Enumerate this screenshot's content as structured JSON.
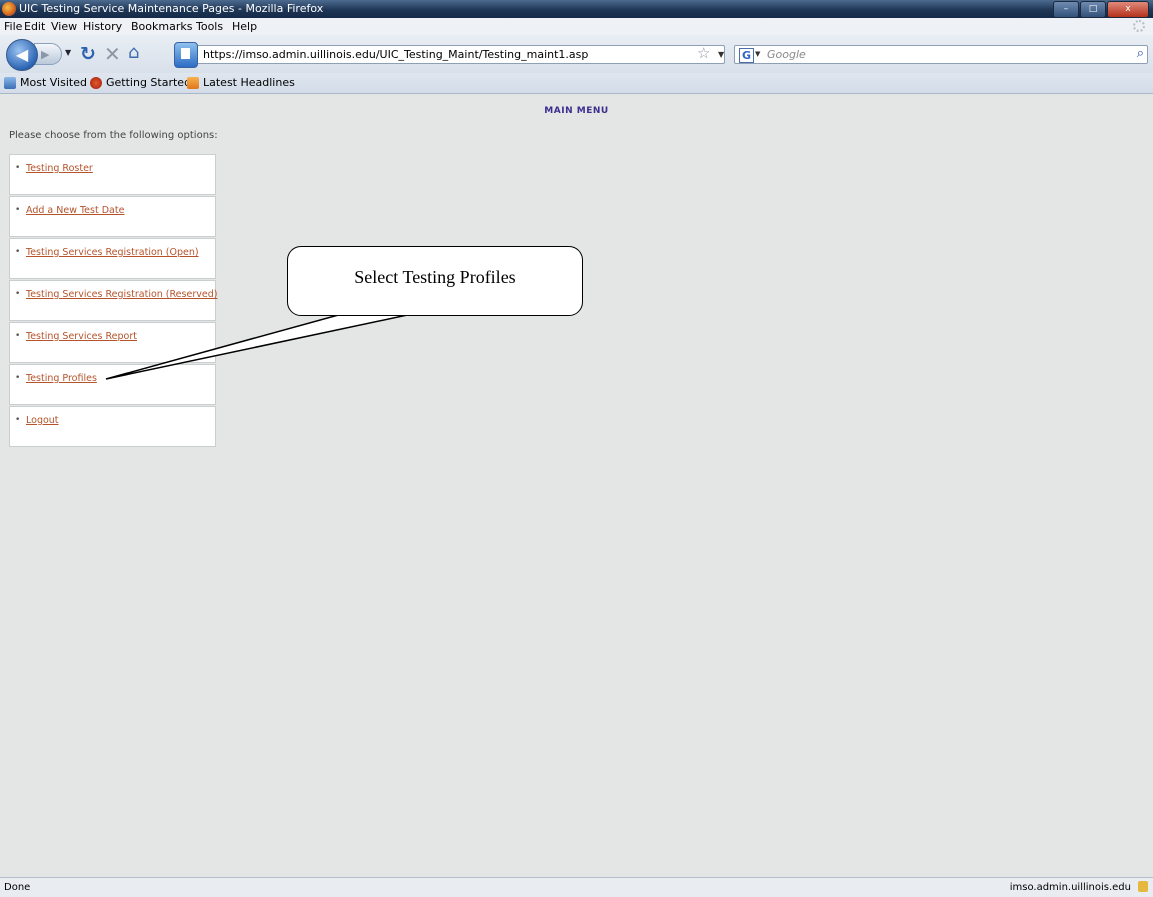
{
  "window": {
    "title": "UIC Testing Service Maintenance Pages - Mozilla Firefox",
    "buttons": [
      "–",
      "□",
      "x"
    ]
  },
  "menubar": {
    "items": [
      {
        "label": "File"
      },
      {
        "label": "Edit"
      },
      {
        "label": "View"
      },
      {
        "label": "History"
      },
      {
        "label": "Bookmarks"
      },
      {
        "label": "Tools"
      },
      {
        "label": "Help"
      }
    ]
  },
  "navbar": {
    "url": "https://imso.admin.uillinois.edu/UIC_Testing_Maint/Testing_maint1.asp",
    "search_placeholder": "Google",
    "search_engine_letter": "G"
  },
  "bookmarks": {
    "items": [
      {
        "label": "Most Visited",
        "icon": "most-visited-icon"
      },
      {
        "label": "Getting Started",
        "icon": "firefox-icon"
      },
      {
        "label": "Latest Headlines",
        "icon": "rss-icon"
      }
    ]
  },
  "page": {
    "heading": "MAIN MENU",
    "prompt": "Please choose from the following options:",
    "options": [
      {
        "label": "Testing Roster"
      },
      {
        "label": "Add a New Test Date"
      },
      {
        "label": "Testing Services Registration (Open)"
      },
      {
        "label": "Testing Services Registration (Reserved)"
      },
      {
        "label": "Testing Services Report"
      },
      {
        "label": "Testing Profiles"
      },
      {
        "label": "Logout"
      }
    ],
    "callout": "Select Testing Profiles"
  },
  "statusbar": {
    "left": "Done",
    "right": "imso.admin.uillinois.edu"
  },
  "colors": {
    "link": "#b5532b",
    "heading": "#3b2f8e",
    "page_bg": "#e3e6e5"
  }
}
